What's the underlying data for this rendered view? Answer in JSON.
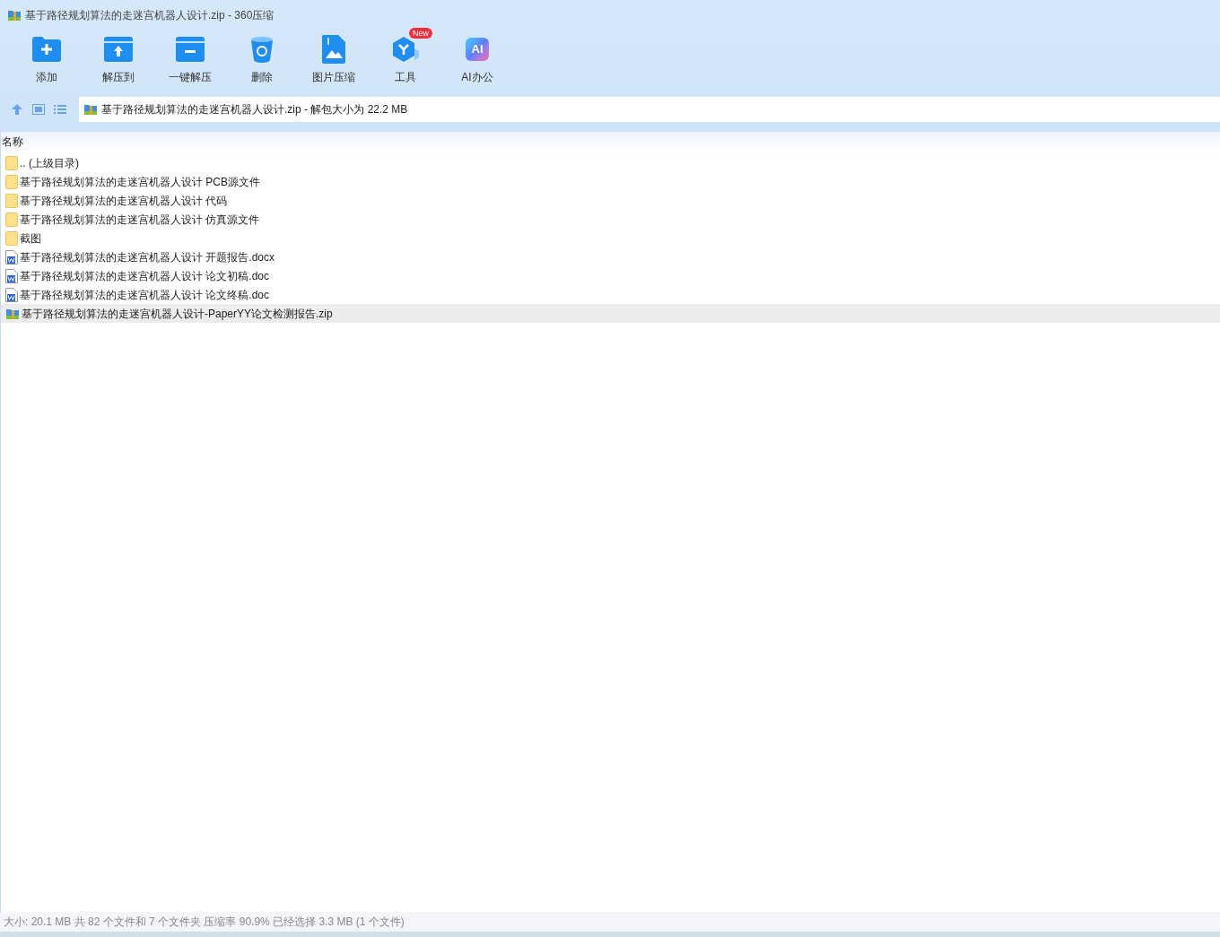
{
  "window": {
    "title": "基于路径规划算法的走迷宫机器人设计.zip - 360压缩"
  },
  "toolbar": [
    {
      "kind": "add",
      "label": "添加"
    },
    {
      "kind": "extract",
      "label": "解压到"
    },
    {
      "kind": "oneclick",
      "label": "一键解压"
    },
    {
      "kind": "delete",
      "label": "删除"
    },
    {
      "kind": "image",
      "label": "图片压缩"
    },
    {
      "kind": "tools",
      "label": "工具",
      "badge": "New"
    },
    {
      "kind": "ai",
      "label": "AI办公",
      "icon_text": "AI"
    }
  ],
  "address_bar": {
    "path": "基于路径规划算法的走迷宫机器人设计.zip - 解包大小为 22.2 MB"
  },
  "file_list": {
    "columns": [
      "名称"
    ],
    "rows": [
      {
        "kind": "folder",
        "name": ".. (上级目录)",
        "selected": false
      },
      {
        "kind": "folder",
        "name": "基于路径规划算法的走迷宫机器人设计 PCB源文件",
        "selected": false
      },
      {
        "kind": "folder",
        "name": "基于路径规划算法的走迷宫机器人设计 代码",
        "selected": false
      },
      {
        "kind": "folder",
        "name": "基于路径规划算法的走迷宫机器人设计 仿真源文件",
        "selected": false
      },
      {
        "kind": "folder",
        "name": "截图",
        "selected": false
      },
      {
        "kind": "word",
        "name": "基于路径规划算法的走迷宫机器人设计 开题报告.docx",
        "selected": false
      },
      {
        "kind": "word",
        "name": "基于路径规划算法的走迷宫机器人设计 论文初稿.doc",
        "selected": false
      },
      {
        "kind": "word",
        "name": "基于路径规划算法的走迷宫机器人设计 论文终稿.doc",
        "selected": false
      },
      {
        "kind": "zip",
        "name": "基于路径规划算法的走迷宫机器人设计-PaperYY论文检测报告.zip",
        "selected": true
      }
    ]
  },
  "status_bar": "大小: 20.1 MB 共 82 个文件和 7 个文件夹 压缩率 90.9% 已经选择 3.3 MB (1 个文件)"
}
